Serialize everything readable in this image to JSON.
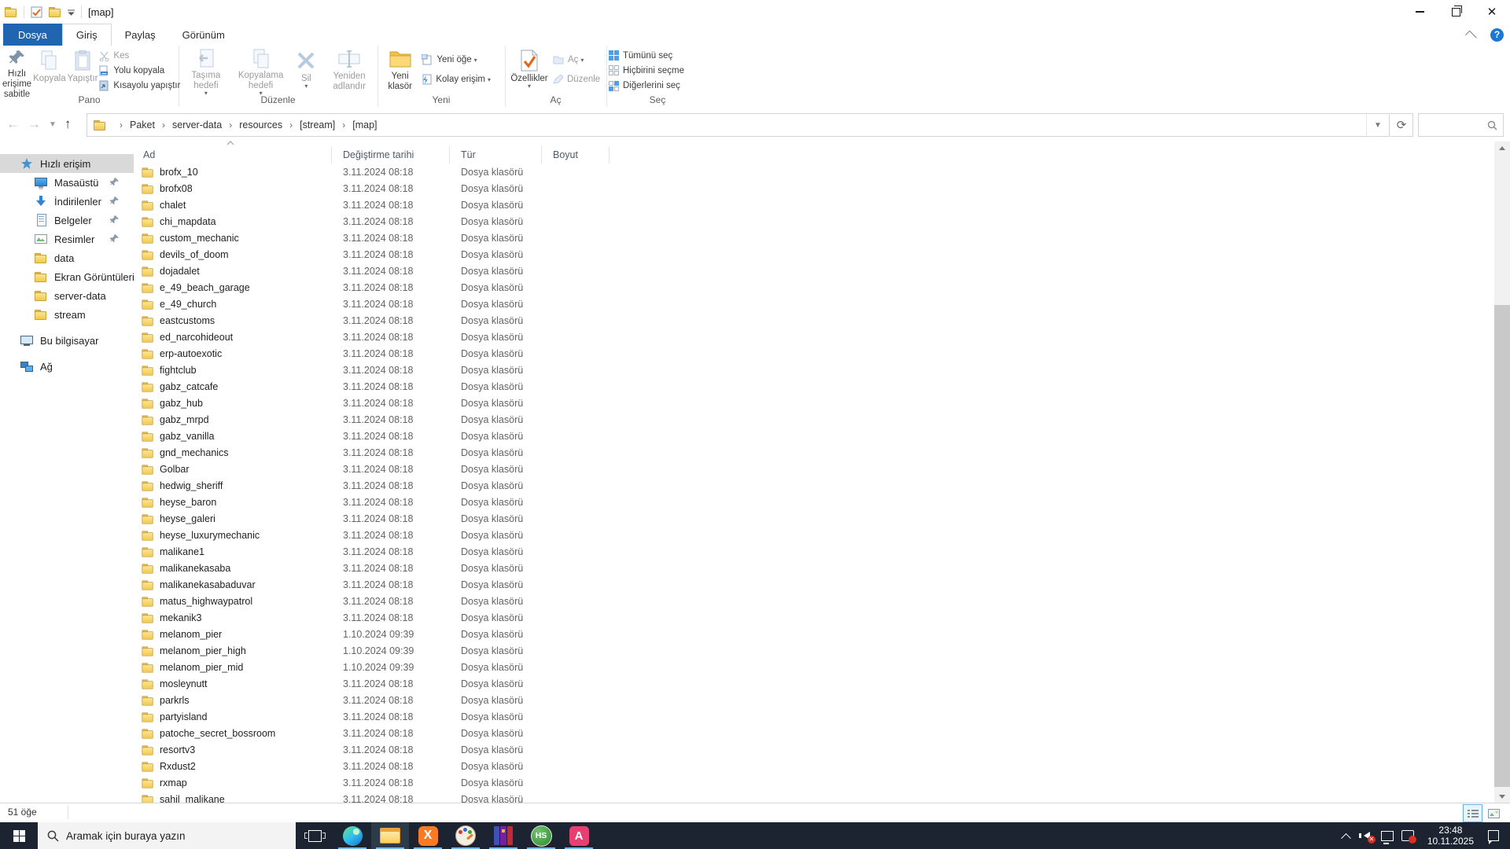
{
  "colors": {
    "accent_blue": "#2065b0",
    "taskbar_bg": "#1b2430",
    "folder_yellow": "#f3c94f",
    "selection_gray": "#d9d9d9",
    "running_indicator": "#76b9ed",
    "properties_check_orange": "#e8641b"
  },
  "window": {
    "title": "[map]"
  },
  "ribbon": {
    "tabs": [
      "Dosya",
      "Giriş",
      "Paylaş",
      "Görünüm"
    ],
    "pano": {
      "label": "Pano",
      "pin": "Hızlı erişime sabitle",
      "copy": "Kopyala",
      "paste": "Yapıştır",
      "cut": "Kes",
      "copy_path": "Yolu kopyala",
      "paste_shortcut": "Kısayolu yapıştır"
    },
    "duzenle": {
      "label": "Düzenle",
      "move_to": "Taşıma hedefi",
      "copy_to": "Kopyalama hedefi",
      "delete": "Sil",
      "rename": "Yeniden adlandır"
    },
    "yeni": {
      "label": "Yeni",
      "new_folder": "Yeni klasör",
      "new_item": "Yeni öğe",
      "easy_access": "Kolay erişim"
    },
    "ac": {
      "label": "Aç",
      "properties": "Özellikler",
      "open": "Aç",
      "edit": "Düzenle"
    },
    "sec": {
      "label": "Seç",
      "select_all": "Tümünü seç",
      "select_none": "Hiçbirini seçme",
      "invert": "Diğerlerini seç"
    }
  },
  "navbar": {
    "breadcrumb": [
      "Paket",
      "server-data",
      "resources",
      "[stream]",
      "[map]"
    ],
    "search_value": ""
  },
  "sidebar": {
    "items": [
      {
        "label": "Hızlı erişim",
        "icon": "quick-access",
        "level": 0,
        "selected": true,
        "pinned": false,
        "gap": false
      },
      {
        "label": "Masaüstü",
        "icon": "desktop",
        "level": 1,
        "selected": false,
        "pinned": true,
        "gap": false
      },
      {
        "label": "İndirilenler",
        "icon": "downloads",
        "level": 1,
        "selected": false,
        "pinned": true,
        "gap": false
      },
      {
        "label": "Belgeler",
        "icon": "documents",
        "level": 1,
        "selected": false,
        "pinned": true,
        "gap": false
      },
      {
        "label": "Resimler",
        "icon": "pictures",
        "level": 1,
        "selected": false,
        "pinned": true,
        "gap": false
      },
      {
        "label": "data",
        "icon": "folder",
        "level": 1,
        "selected": false,
        "pinned": false,
        "gap": false
      },
      {
        "label": "Ekran Görüntüleri",
        "icon": "folder",
        "level": 1,
        "selected": false,
        "pinned": false,
        "gap": false
      },
      {
        "label": "server-data",
        "icon": "folder",
        "level": 1,
        "selected": false,
        "pinned": false,
        "gap": false
      },
      {
        "label": "stream",
        "icon": "folder",
        "level": 1,
        "selected": false,
        "pinned": false,
        "gap": false
      },
      {
        "label": "Bu bilgisayar",
        "icon": "pc",
        "level": 0,
        "selected": false,
        "pinned": false,
        "gap": true
      },
      {
        "label": "Ağ",
        "icon": "network",
        "level": 0,
        "selected": false,
        "pinned": false,
        "gap": true
      }
    ]
  },
  "filelist": {
    "columns": {
      "name": "Ad",
      "date": "Değiştirme tarihi",
      "type": "Tür",
      "size": "Boyut"
    },
    "rows": [
      {
        "name": "brofx_10",
        "date": "3.11.2024 08:18",
        "type": "Dosya klasörü",
        "size": ""
      },
      {
        "name": "brofx08",
        "date": "3.11.2024 08:18",
        "type": "Dosya klasörü",
        "size": ""
      },
      {
        "name": "chalet",
        "date": "3.11.2024 08:18",
        "type": "Dosya klasörü",
        "size": ""
      },
      {
        "name": "chi_mapdata",
        "date": "3.11.2024 08:18",
        "type": "Dosya klasörü",
        "size": ""
      },
      {
        "name": "custom_mechanic",
        "date": "3.11.2024 08:18",
        "type": "Dosya klasörü",
        "size": ""
      },
      {
        "name": "devils_of_doom",
        "date": "3.11.2024 08:18",
        "type": "Dosya klasörü",
        "size": ""
      },
      {
        "name": "dojadalet",
        "date": "3.11.2024 08:18",
        "type": "Dosya klasörü",
        "size": ""
      },
      {
        "name": "e_49_beach_garage",
        "date": "3.11.2024 08:18",
        "type": "Dosya klasörü",
        "size": ""
      },
      {
        "name": "e_49_church",
        "date": "3.11.2024 08:18",
        "type": "Dosya klasörü",
        "size": ""
      },
      {
        "name": "eastcustoms",
        "date": "3.11.2024 08:18",
        "type": "Dosya klasörü",
        "size": ""
      },
      {
        "name": "ed_narcohideout",
        "date": "3.11.2024 08:18",
        "type": "Dosya klasörü",
        "size": ""
      },
      {
        "name": "erp-autoexotic",
        "date": "3.11.2024 08:18",
        "type": "Dosya klasörü",
        "size": ""
      },
      {
        "name": "fightclub",
        "date": "3.11.2024 08:18",
        "type": "Dosya klasörü",
        "size": ""
      },
      {
        "name": "gabz_catcafe",
        "date": "3.11.2024 08:18",
        "type": "Dosya klasörü",
        "size": ""
      },
      {
        "name": "gabz_hub",
        "date": "3.11.2024 08:18",
        "type": "Dosya klasörü",
        "size": ""
      },
      {
        "name": "gabz_mrpd",
        "date": "3.11.2024 08:18",
        "type": "Dosya klasörü",
        "size": ""
      },
      {
        "name": "gabz_vanilla",
        "date": "3.11.2024 08:18",
        "type": "Dosya klasörü",
        "size": ""
      },
      {
        "name": "gnd_mechanics",
        "date": "3.11.2024 08:18",
        "type": "Dosya klasörü",
        "size": ""
      },
      {
        "name": "Golbar",
        "date": "3.11.2024 08:18",
        "type": "Dosya klasörü",
        "size": ""
      },
      {
        "name": "hedwig_sheriff",
        "date": "3.11.2024 08:18",
        "type": "Dosya klasörü",
        "size": ""
      },
      {
        "name": "heyse_baron",
        "date": "3.11.2024 08:18",
        "type": "Dosya klasörü",
        "size": ""
      },
      {
        "name": "heyse_galeri",
        "date": "3.11.2024 08:18",
        "type": "Dosya klasörü",
        "size": ""
      },
      {
        "name": "heyse_luxurymechanic",
        "date": "3.11.2024 08:18",
        "type": "Dosya klasörü",
        "size": ""
      },
      {
        "name": "malikane1",
        "date": "3.11.2024 08:18",
        "type": "Dosya klasörü",
        "size": ""
      },
      {
        "name": "malikanekasaba",
        "date": "3.11.2024 08:18",
        "type": "Dosya klasörü",
        "size": ""
      },
      {
        "name": "malikanekasabaduvar",
        "date": "3.11.2024 08:18",
        "type": "Dosya klasörü",
        "size": ""
      },
      {
        "name": "matus_highwaypatrol",
        "date": "3.11.2024 08:18",
        "type": "Dosya klasörü",
        "size": ""
      },
      {
        "name": "mekanik3",
        "date": "3.11.2024 08:18",
        "type": "Dosya klasörü",
        "size": ""
      },
      {
        "name": "melanom_pier",
        "date": "1.10.2024 09:39",
        "type": "Dosya klasörü",
        "size": ""
      },
      {
        "name": "melanom_pier_high",
        "date": "1.10.2024 09:39",
        "type": "Dosya klasörü",
        "size": ""
      },
      {
        "name": "melanom_pier_mid",
        "date": "1.10.2024 09:39",
        "type": "Dosya klasörü",
        "size": ""
      },
      {
        "name": "mosleynutt",
        "date": "3.11.2024 08:18",
        "type": "Dosya klasörü",
        "size": ""
      },
      {
        "name": "parkrls",
        "date": "3.11.2024 08:18",
        "type": "Dosya klasörü",
        "size": ""
      },
      {
        "name": "partyisland",
        "date": "3.11.2024 08:18",
        "type": "Dosya klasörü",
        "size": ""
      },
      {
        "name": "patoche_secret_bossroom",
        "date": "3.11.2024 08:18",
        "type": "Dosya klasörü",
        "size": ""
      },
      {
        "name": "resortv3",
        "date": "3.11.2024 08:18",
        "type": "Dosya klasörü",
        "size": ""
      },
      {
        "name": "Rxdust2",
        "date": "3.11.2024 08:18",
        "type": "Dosya klasörü",
        "size": ""
      },
      {
        "name": "rxmap",
        "date": "3.11.2024 08:18",
        "type": "Dosya klasörü",
        "size": ""
      },
      {
        "name": "sahil_malikane",
        "date": "3.11.2024 08:18",
        "type": "Dosya klasörü",
        "size": ""
      }
    ]
  },
  "statusbar": {
    "count": "51 öğe"
  },
  "taskbar": {
    "search_placeholder": "Aramak için buraya yazın",
    "time": "23:48",
    "date": "10.11.2025",
    "hs_label": "HS",
    "xampp_label": "X",
    "appa_label": "A"
  }
}
